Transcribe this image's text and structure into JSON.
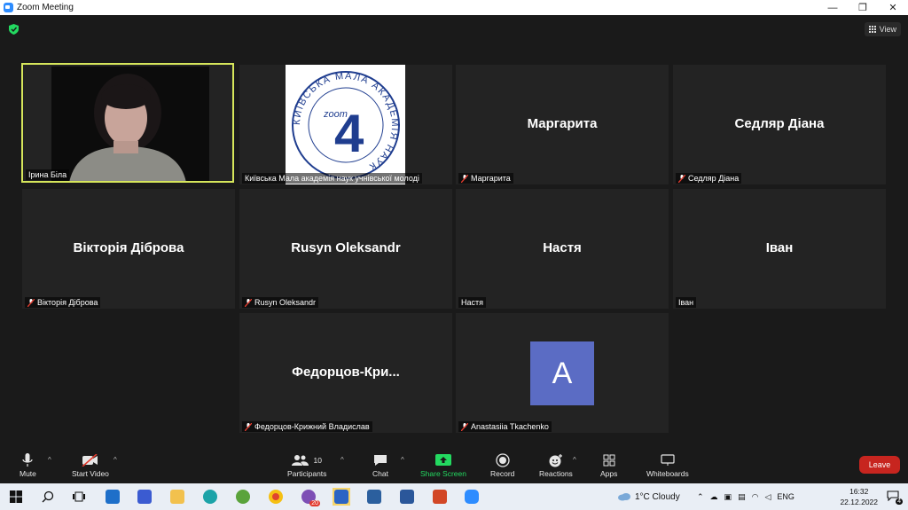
{
  "window": {
    "title": "Zoom Meeting",
    "min": "—",
    "restore": "❐",
    "close": "✕"
  },
  "view_button": {
    "label": "View"
  },
  "tiles": {
    "t1": {
      "label": "Ірина Біла"
    },
    "t2": {
      "label": "Київська Мала академія наук учнівської молоді",
      "logo_ring_text": "КИЇВСЬКА МАЛА АКАДЕМІЯ НАУК",
      "logo_zoom": "zoom",
      "logo_number": "4"
    },
    "t3": {
      "big": "Маргарита",
      "label": "Маргарита"
    },
    "t4": {
      "big": "Седляр Діана",
      "label": "Седляр Діана"
    },
    "t5": {
      "big": "Вікторія Діброва",
      "label": "Вікторія Діброва"
    },
    "t6": {
      "big": "Rusyn Oleksandr",
      "label": "Rusyn Oleksandr"
    },
    "t7": {
      "big": "Настя",
      "label": "Настя"
    },
    "t8": {
      "big": "Іван",
      "label": "Іван"
    },
    "t9": {
      "big": "Федорцов-Кри...",
      "label": "Федорцов-Крижний Владислав"
    },
    "t10": {
      "avatar": "A",
      "label": "Anastasiia Tkachenko"
    }
  },
  "toolbar": {
    "mute": "Mute",
    "start_video": "Start Video",
    "participants": "Participants",
    "participants_count": "10",
    "chat": "Chat",
    "share_screen": "Share Screen",
    "record": "Record",
    "reactions": "Reactions",
    "apps": "Apps",
    "whiteboards": "Whiteboards",
    "leave": "Leave",
    "caret": "^"
  },
  "taskbar": {
    "weather": "1°C  Cloudy",
    "lang": "ENG",
    "time": "16:32",
    "date": "22.12.2022",
    "notifications": "4",
    "viber_badge": "20"
  },
  "colors": {
    "accent_green": "#23d960",
    "leave_red": "#c7251f",
    "active_border": "#d6e65b",
    "avatar_bg": "#5b6cc4"
  }
}
